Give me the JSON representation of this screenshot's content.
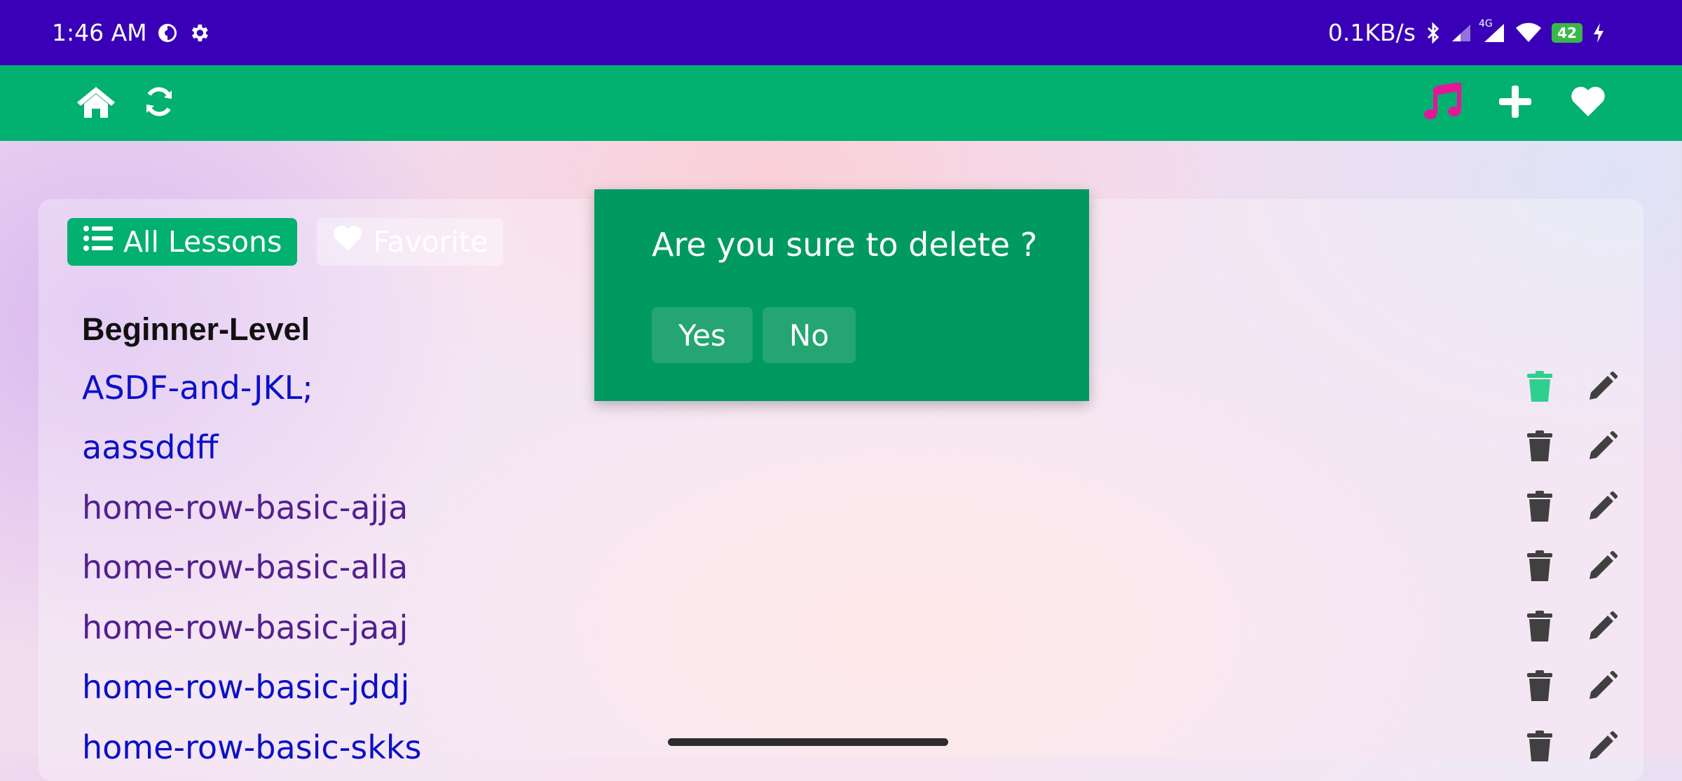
{
  "status_bar": {
    "time": "1:46 AM",
    "net_speed": "0.1KB/s",
    "network_type": "4G",
    "battery": "42",
    "icons": [
      "clock-app-icon",
      "settings-icon",
      "bluetooth-icon",
      "signal-icon",
      "signal-4g-icon",
      "wifi-icon",
      "battery-icon",
      "charging-icon"
    ]
  },
  "toolbar": {
    "left_icons": [
      "home-icon",
      "refresh-icon"
    ],
    "right_icons": [
      "music-note-icon",
      "plus-icon",
      "heart-icon"
    ],
    "music_color": "#e4169a",
    "background": "#02b06f"
  },
  "tabs": [
    {
      "label": "All Lessons",
      "icon": "list-icon",
      "active": true
    },
    {
      "label": "Favorite",
      "icon": "heart-icon",
      "active": false
    }
  ],
  "section": {
    "title": "Beginner-Level",
    "lessons": [
      {
        "name": "ASDF-and-JKL;",
        "visited": false,
        "delete_highlight": true
      },
      {
        "name": "aassddff",
        "visited": false,
        "delete_highlight": false
      },
      {
        "name": "home-row-basic-ajja",
        "visited": true,
        "delete_highlight": false
      },
      {
        "name": "home-row-basic-alla",
        "visited": true,
        "delete_highlight": false
      },
      {
        "name": "home-row-basic-jaaj",
        "visited": true,
        "delete_highlight": false
      },
      {
        "name": "home-row-basic-jddj",
        "visited": false,
        "delete_highlight": false
      },
      {
        "name": "home-row-basic-skks",
        "visited": false,
        "delete_highlight": false
      }
    ]
  },
  "dialog": {
    "message": "Are you sure to delete ?",
    "yes_label": "Yes",
    "no_label": "No"
  },
  "colors": {
    "status_bar": "#3900b8",
    "accent": "#02b06f",
    "dialog": "#009a61",
    "link_unvisited": "#0b10c8",
    "link_visited": "#52208f",
    "delete_highlight": "#2fcf8f",
    "icon_dark": "#404040"
  }
}
